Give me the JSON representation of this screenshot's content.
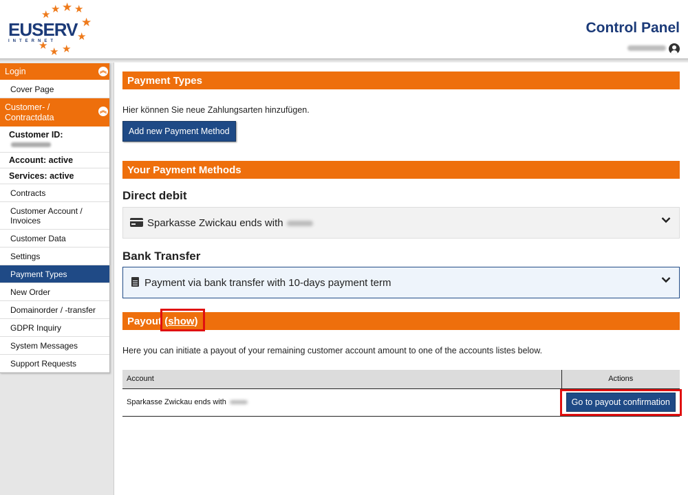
{
  "header": {
    "logo_text": "EUSERV",
    "logo_sub": "INTERNET",
    "title": "Control Panel",
    "user_icon": "user-circle-icon"
  },
  "sidebar": {
    "login_label": "Login",
    "cover_page": "Cover Page",
    "customer_section": "Customer- / Contractdata",
    "customer_id_label": "Customer ID:",
    "account_status": "Account: active",
    "services_status": "Services: active",
    "items": [
      {
        "label": "Contracts",
        "active": false
      },
      {
        "label": "Customer Account / Invoices",
        "active": false
      },
      {
        "label": "Customer Data",
        "active": false
      },
      {
        "label": "Settings",
        "active": false
      },
      {
        "label": "Payment Types",
        "active": true
      },
      {
        "label": "New Order",
        "active": false
      },
      {
        "label": "Domainorder / -transfer",
        "active": false
      },
      {
        "label": "GDPR Inquiry",
        "active": false
      },
      {
        "label": "System Messages",
        "active": false
      },
      {
        "label": "Support Requests",
        "active": false
      }
    ]
  },
  "main": {
    "payment_types_title": "Payment Types",
    "intro_text": "Hier können Sie neue Zahlungsarten hinzufügen.",
    "add_button": "Add new Payment Method",
    "your_methods_title": "Your Payment Methods",
    "direct_debit_title": "Direct debit",
    "direct_debit_text": "Sparkasse Zwickau ends with",
    "bank_transfer_title": "Bank Transfer",
    "bank_transfer_text": "Payment via bank transfer with 10-days payment term",
    "payout_title": "Payout",
    "payout_show_open": "(",
    "payout_show": "show",
    "payout_show_close": ")",
    "payout_text": "Here you can initiate a payout of your remaining customer account amount to one of the accounts listes below.",
    "table": {
      "col_account": "Account",
      "col_actions": "Actions",
      "row_account": "Sparkasse Zwickau ends with",
      "row_button": "Go to payout confirmation"
    }
  },
  "colors": {
    "accent_orange": "#ee6f0c",
    "brand_blue": "#1f4a86",
    "highlight_red": "#e01010"
  }
}
